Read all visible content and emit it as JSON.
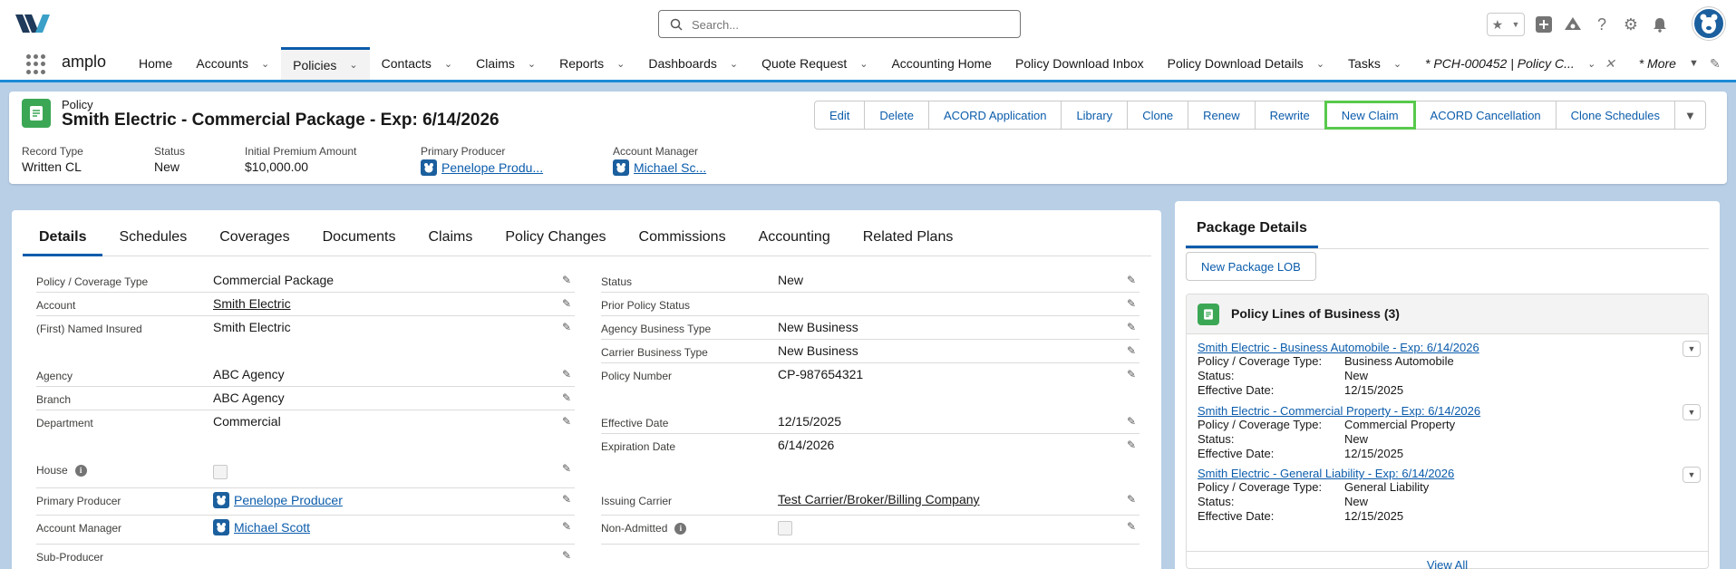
{
  "header": {
    "search_placeholder": "Search..."
  },
  "nav": {
    "app_name": "amplo",
    "items": [
      {
        "label": "Home",
        "chevron": false
      },
      {
        "label": "Accounts",
        "chevron": true
      },
      {
        "label": "Policies",
        "chevron": true,
        "active": true
      },
      {
        "label": "Contacts",
        "chevron": true
      },
      {
        "label": "Claims",
        "chevron": true
      },
      {
        "label": "Reports",
        "chevron": true
      },
      {
        "label": "Dashboards",
        "chevron": true
      },
      {
        "label": "Quote Request",
        "chevron": true
      },
      {
        "label": "Accounting Home",
        "chevron": false
      },
      {
        "label": "Policy Download Inbox",
        "chevron": false
      },
      {
        "label": "Policy Download Details",
        "chevron": true
      },
      {
        "label": "Tasks",
        "chevron": true
      }
    ],
    "open_tab": "* PCH-000452 | Policy C...",
    "more": "* More"
  },
  "highlights": {
    "object_label": "Policy",
    "title": "Smith Electric - Commercial Package - Exp: 6/14/2026",
    "buttons": [
      "Edit",
      "Delete",
      "ACORD Application",
      "Library",
      "Clone",
      "Renew",
      "Rewrite",
      "New Claim",
      "ACORD Cancellation",
      "Clone Schedules"
    ],
    "fields": {
      "record_type_label": "Record Type",
      "record_type_value": "Written CL",
      "status_label": "Status",
      "status_value": "New",
      "premium_label": "Initial Premium Amount",
      "premium_value": "$10,000.00",
      "producer_label": "Primary Producer",
      "producer_value": "Penelope Produ...",
      "manager_label": "Account Manager",
      "manager_value": "Michael Sc..."
    }
  },
  "tabs": [
    "Details",
    "Schedules",
    "Coverages",
    "Documents",
    "Claims",
    "Policy Changes",
    "Commissions",
    "Accounting",
    "Related Plans"
  ],
  "details": {
    "left": {
      "coverage_type": {
        "label": "Policy / Coverage Type",
        "value": "Commercial Package"
      },
      "account": {
        "label": "Account",
        "value": "Smith Electric"
      },
      "named_insured": {
        "label": "(First) Named Insured",
        "value": "Smith Electric"
      },
      "agency": {
        "label": "Agency",
        "value": "ABC Agency"
      },
      "branch": {
        "label": "Branch",
        "value": "ABC Agency"
      },
      "department": {
        "label": "Department",
        "value": "Commercial"
      },
      "house": {
        "label": "House"
      },
      "primary_producer": {
        "label": "Primary Producer",
        "value": "Penelope Producer"
      },
      "account_manager": {
        "label": "Account Manager",
        "value": "Michael Scott"
      },
      "sub_producer": {
        "label": "Sub-Producer"
      }
    },
    "right": {
      "status": {
        "label": "Status",
        "value": "New"
      },
      "prior_status": {
        "label": "Prior Policy Status"
      },
      "agency_business_type": {
        "label": "Agency Business Type",
        "value": "New Business"
      },
      "carrier_business_type": {
        "label": "Carrier Business Type",
        "value": "New Business"
      },
      "policy_number": {
        "label": "Policy Number",
        "value": "CP-987654321"
      },
      "effective_date": {
        "label": "Effective Date",
        "value": "12/15/2025"
      },
      "expiration_date": {
        "label": "Expiration Date",
        "value": "6/14/2026"
      },
      "issuing_carrier": {
        "label": "Issuing Carrier",
        "value": "Test Carrier/Broker/Billing Company"
      },
      "non_admitted": {
        "label": "Non-Admitted"
      }
    }
  },
  "package": {
    "tab": "Package Details",
    "new_button": "New Package LOB",
    "related_title": "Policy Lines of Business (3)",
    "labels": {
      "type": "Policy / Coverage Type:",
      "status": "Status:",
      "effective": "Effective Date:"
    },
    "records": [
      {
        "name": "Smith Electric - Business Automobile - Exp: 6/14/2026",
        "type": "Business Automobile",
        "status": "New",
        "effective": "12/15/2025"
      },
      {
        "name": "Smith Electric - Commercial Property - Exp: 6/14/2026",
        "type": "Commercial Property",
        "status": "New",
        "effective": "12/15/2025"
      },
      {
        "name": "Smith Electric - General Liability - Exp: 6/14/2026",
        "type": "General Liability",
        "status": "New",
        "effective": "12/15/2025"
      }
    ],
    "view_all": "View All"
  }
}
